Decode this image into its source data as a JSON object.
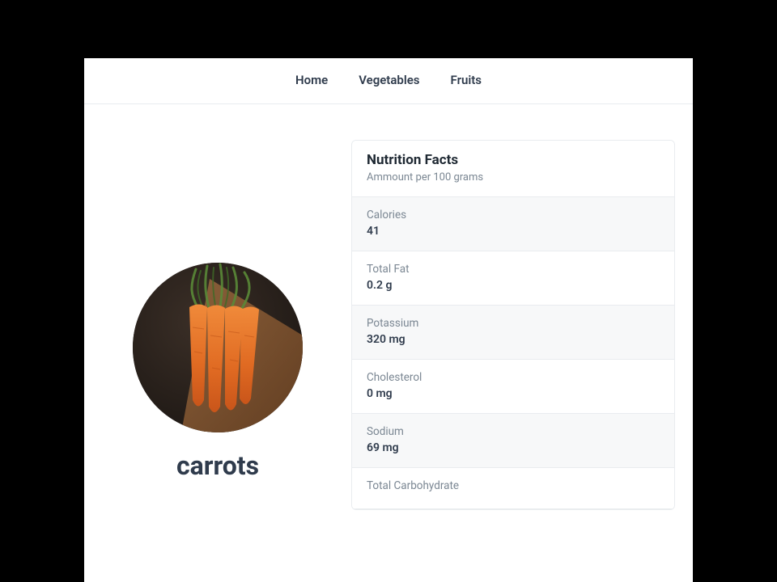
{
  "nav": {
    "items": [
      {
        "label": "Home"
      },
      {
        "label": "Vegetables"
      },
      {
        "label": "Fruits"
      }
    ]
  },
  "food": {
    "title": "carrots",
    "image_alt": "carrots"
  },
  "nutrition": {
    "heading": "Nutrition Facts",
    "subheading": "Ammount per 100 grams",
    "facts": [
      {
        "label": "Calories",
        "value": "41"
      },
      {
        "label": "Total Fat",
        "value": "0.2 g"
      },
      {
        "label": "Potassium",
        "value": "320 mg"
      },
      {
        "label": "Cholesterol",
        "value": "0 mg"
      },
      {
        "label": "Sodium",
        "value": "69 mg"
      },
      {
        "label": "Total Carbohydrate",
        "value": ""
      }
    ]
  }
}
